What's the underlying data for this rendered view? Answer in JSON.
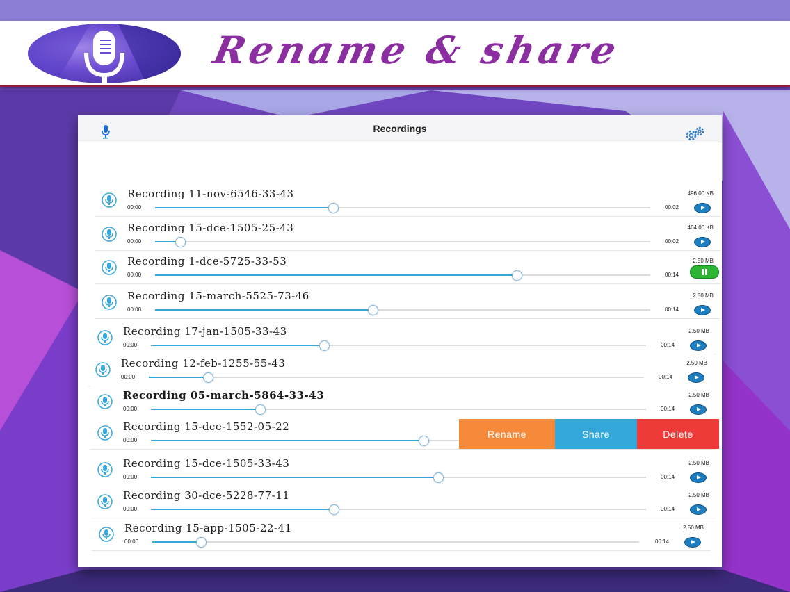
{
  "banner": {
    "title": "Rename & share",
    "logo_icon": "microphone-icon"
  },
  "navbar": {
    "title": "Recordings",
    "left_icon": "microphone-icon",
    "right_icon": "gears-icon"
  },
  "colors": {
    "accent": "#33a8d6",
    "title_purple": "#8b2fa0",
    "rename": "#f58a3a",
    "share": "#34a8db",
    "delete": "#ef3a3a",
    "playing": "#2bb533"
  },
  "recordings": [
    {
      "name": "Recording 11-nov-6546-33-43",
      "size": "496.00 KB",
      "start": "00:00",
      "end": "00:02",
      "progress": 0.36,
      "state": "play"
    },
    {
      "name": "Recording 15-dce-1505-25-43",
      "size": "404.00 KB",
      "start": "00:00",
      "end": "00:02",
      "progress": 0.05,
      "state": "play"
    },
    {
      "name": "Recording 1-dce-5725-33-53",
      "size": "2.50 MB",
      "start": "00:00",
      "end": "00:14",
      "progress": 0.73,
      "state": "pause"
    },
    {
      "name": "Recording 15-march-5525-73-46",
      "size": "2.50 MB",
      "start": "00:00",
      "end": "00:14",
      "progress": 0.44,
      "state": "play"
    },
    {
      "name": "Recording 17-jan-1505-33-43",
      "size": "2.50 MB",
      "start": "00:00",
      "end": "00:14",
      "progress": 0.35,
      "state": "play"
    },
    {
      "name": "Recording 12-feb-1255-55-43",
      "size": "2.50 MB",
      "start": "00:00",
      "end": "00:14",
      "progress": 0.12,
      "state": "play"
    },
    {
      "name": "Recording 05-march-5864-33-43",
      "size": "2.50 MB",
      "start": "00:00",
      "end": "00:14",
      "progress": 0.22,
      "state": "play",
      "bold": true
    },
    {
      "name": "Recording 15-dce-1552-05-22",
      "size": "",
      "start": "00:00",
      "end": "",
      "progress": 0.55,
      "state": "swiped"
    },
    {
      "name": "Recording 15-dce-1505-33-43",
      "size": "2.50 MB",
      "start": "00:00",
      "end": "00:14",
      "progress": 0.58,
      "state": "play"
    },
    {
      "name": "Recording 30-dce-5228-77-11",
      "size": "2.50 MB",
      "start": "00:00",
      "end": "00:14",
      "progress": 0.37,
      "state": "play"
    },
    {
      "name": "Recording 15-app-1505-22-41",
      "size": "2.50 MB",
      "start": "00:00",
      "end": "00:14",
      "progress": 0.1,
      "state": "play"
    }
  ],
  "swipe_actions": {
    "rename": "Rename",
    "share": "Share",
    "delete": "Delete"
  }
}
